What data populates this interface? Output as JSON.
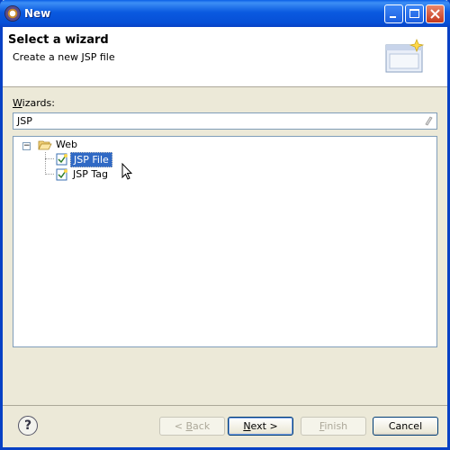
{
  "window": {
    "title": "New"
  },
  "header": {
    "title": "Select a wizard",
    "description": "Create a new JSP file"
  },
  "wizards": {
    "label_mnemonic": "W",
    "label_rest": "izards:",
    "filter_value": "JSP"
  },
  "tree": {
    "folder": "Web",
    "items": [
      {
        "label": "JSP File",
        "selected": true
      },
      {
        "label": "JSP Tag",
        "selected": false
      }
    ]
  },
  "buttons": {
    "back": {
      "prefix": "< ",
      "mnemonic": "B",
      "rest": "ack"
    },
    "next": {
      "mnemonic": "N",
      "rest": "ext >"
    },
    "finish": {
      "mnemonic": "F",
      "rest": "inish"
    },
    "cancel": {
      "label": "Cancel"
    }
  },
  "colors": {
    "titlebar": "#0a5ae0",
    "selection": "#316ac5",
    "dialog_bg": "#ece9d8"
  }
}
